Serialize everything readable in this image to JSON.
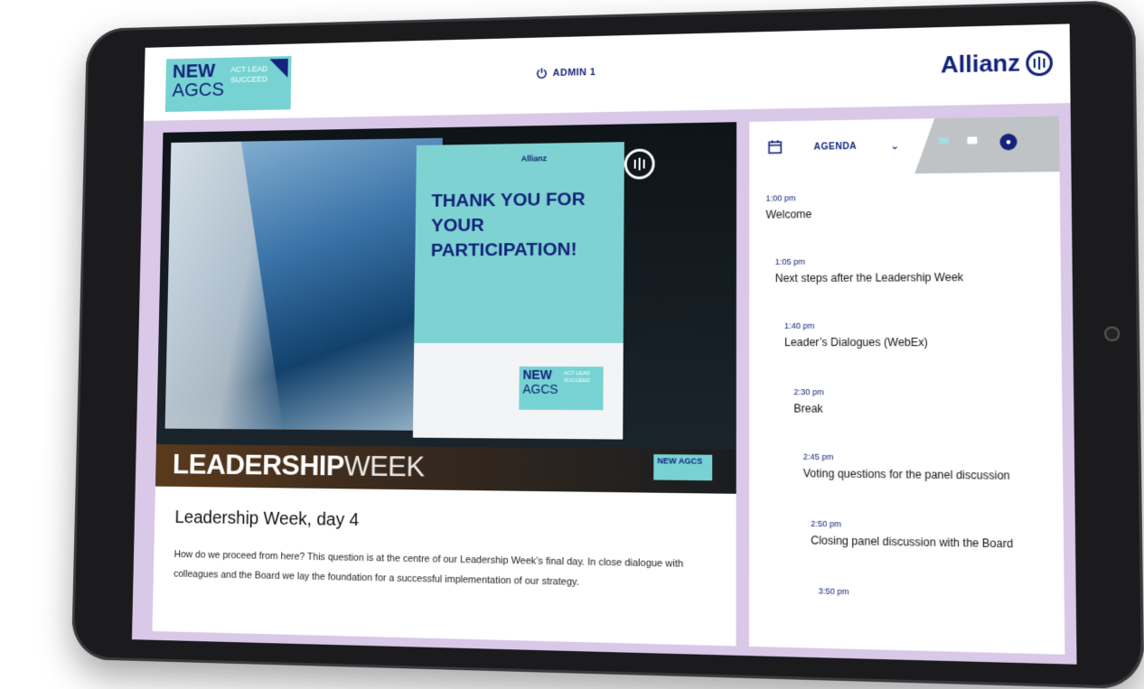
{
  "header": {
    "logo_new": "NEW",
    "logo_agcs": "AGCS",
    "logo_tagline": "ACT LEAD SUCCEED",
    "admin_label": "ADMIN 1",
    "brand": "Allianz"
  },
  "hero": {
    "slide_brand": "Allianz",
    "slide_message": "THANK YOU FOR YOUR PARTICIPATION!",
    "slide_logo_new": "NEW",
    "slide_logo_agcs": "AGCS",
    "slide_logo_tagline": "ACT LEAD SUCCEED",
    "banner_bold": "LEADERSHIP",
    "banner_light": "WEEK",
    "small_logo": "NEW AGCS"
  },
  "article": {
    "title": "Leadership Week, day 4",
    "body": "How do we proceed from here? This question is at the centre of our Leadership Week’s final day. In close dialogue with colleagues and the Board we lay the foundation for a successful implementation of our strategy."
  },
  "sidebar": {
    "agenda_label": "AGENDA",
    "items": [
      {
        "time": "1:00 pm",
        "title": "Welcome"
      },
      {
        "time": "1:05 pm",
        "title": "Next steps after the Leadership Week"
      },
      {
        "time": "1:40 pm",
        "title": "Leader’s Dialogues (WebEx)"
      },
      {
        "time": "2:30 pm",
        "title": "Break"
      },
      {
        "time": "2:45 pm",
        "title": "Voting questions for the panel discussion"
      },
      {
        "time": "2:50 pm",
        "title": "Closing panel discussion with the Board"
      },
      {
        "time": "3:50 pm",
        "title": ""
      }
    ]
  },
  "colors": {
    "brand_blue": "#13237a",
    "teal": "#77d3d3",
    "lavender": "#d9c8e8"
  },
  "icons": [
    "power-icon",
    "calendar-icon",
    "chevron-down-icon",
    "chat-icon",
    "message-icon",
    "info-icon"
  ]
}
